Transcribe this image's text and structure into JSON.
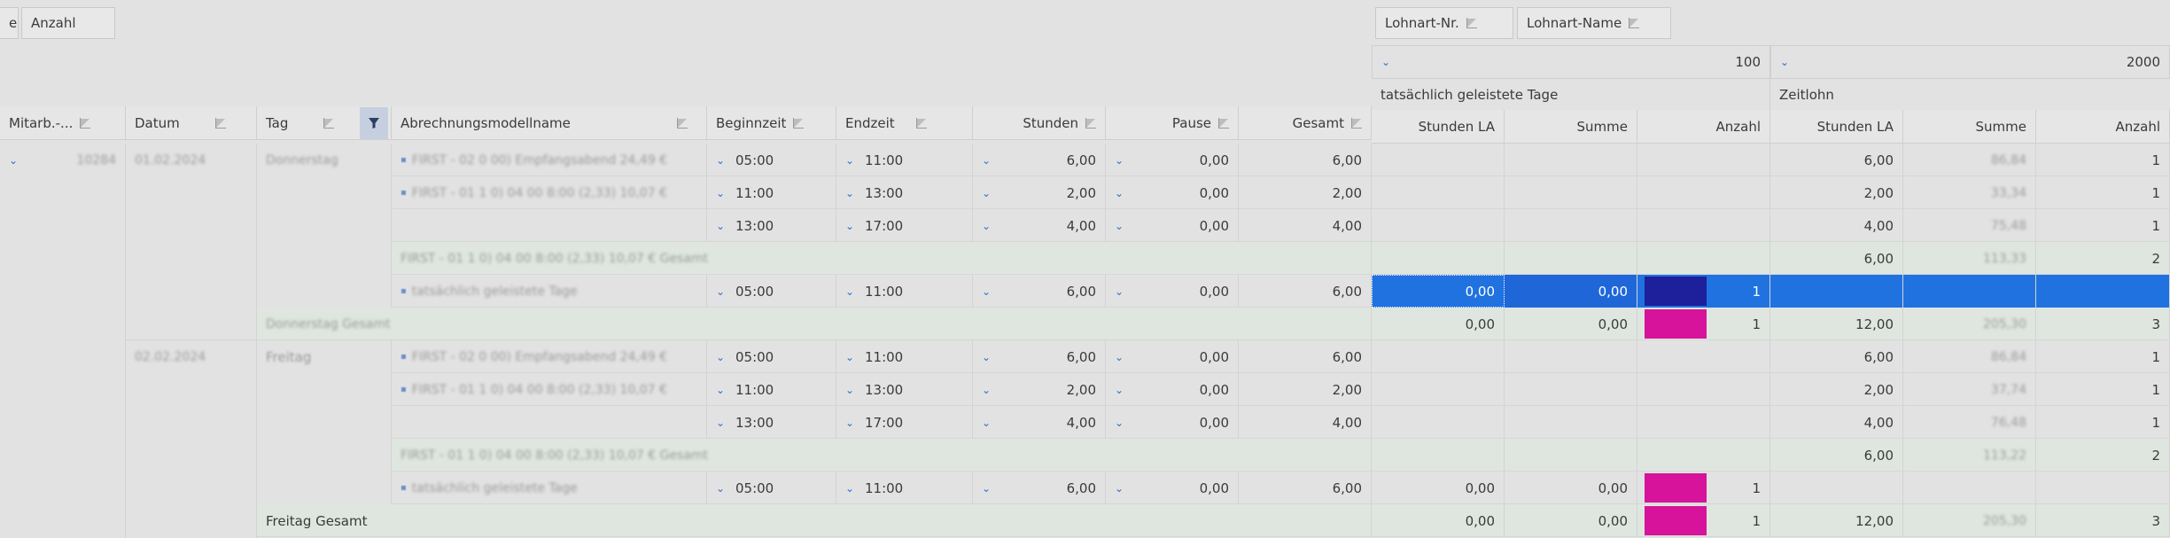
{
  "group_chips": [
    "e",
    "Anzahl"
  ],
  "pivot_chips": [
    "Lohnart-Nr.",
    "Lohnart-Name"
  ],
  "pivot_groups": [
    {
      "nr": "100",
      "name": "tatsächlich geleistete Tage"
    },
    {
      "nr": "2000",
      "name": "Zeitlohn"
    }
  ],
  "columns": [
    "Mitarb.-...",
    "Datum",
    "Tag",
    "Abrechnungsmodellname",
    "Beginnzeit",
    "Endzeit",
    "Stunden",
    "Pause",
    "Gesamt"
  ],
  "value_columns": [
    "Stunden LA",
    "Summe",
    "Anzahl",
    "Stunden LA",
    "Summe",
    "Anzahl"
  ],
  "mitarb_value": "10284",
  "dates": [
    "01.02.2024",
    "02.02.2024"
  ],
  "days": [
    "Donnerstag",
    "Freitag"
  ],
  "models": [
    "FIRST - 02 0 00) Empfangsabend 24,49 €",
    "FIRST - 01 1 0) 04 00 8:00 (2,33) 10,07 €",
    "FIRST - 01 1 0) 04 00 8:00 (2,33) 10,07 € Gesamt",
    "tatsächlich geleistete Tage"
  ],
  "day_totals": [
    "Donnerstag Gesamt",
    "Freitag Gesamt"
  ],
  "rows": [
    {
      "begin": "05:00",
      "end": "11:00",
      "stunden": "6,00",
      "pause": "0,00",
      "gesamt": "6,00",
      "p1": [
        "",
        "",
        ""
      ],
      "p2": [
        "6,00",
        "86,84",
        "1"
      ]
    },
    {
      "begin": "11:00",
      "end": "13:00",
      "stunden": "2,00",
      "pause": "0,00",
      "gesamt": "2,00",
      "p1": [
        "",
        "",
        ""
      ],
      "p2": [
        "2,00",
        "33,34",
        "1"
      ]
    },
    {
      "begin": "13:00",
      "end": "17:00",
      "stunden": "4,00",
      "pause": "0,00",
      "gesamt": "4,00",
      "p1": [
        "",
        "",
        ""
      ],
      "p2": [
        "4,00",
        "75,48",
        "1"
      ]
    },
    {
      "p2": [
        "6,00",
        "113,33",
        "2"
      ]
    },
    {
      "begin": "05:00",
      "end": "11:00",
      "stunden": "6,00",
      "pause": "0,00",
      "gesamt": "6,00",
      "p1": [
        "0,00",
        "0,00",
        "1"
      ]
    },
    {
      "p1": [
        "0,00",
        "0,00",
        "1"
      ],
      "p2": [
        "12,00",
        "205,30",
        "3"
      ]
    },
    {
      "begin": "05:00",
      "end": "11:00",
      "stunden": "6,00",
      "pause": "0,00",
      "gesamt": "6,00",
      "p2": [
        "6,00",
        "86,84",
        "1"
      ]
    },
    {
      "begin": "11:00",
      "end": "13:00",
      "stunden": "2,00",
      "pause": "0,00",
      "gesamt": "2,00",
      "p2": [
        "2,00",
        "37,74",
        "1"
      ]
    },
    {
      "begin": "13:00",
      "end": "17:00",
      "stunden": "4,00",
      "pause": "0,00",
      "gesamt": "4,00",
      "p2": [
        "4,00",
        "76,48",
        "1"
      ]
    },
    {
      "p2": [
        "6,00",
        "113,22",
        "2"
      ]
    },
    {
      "begin": "05:00",
      "end": "11:00",
      "stunden": "6,00",
      "pause": "0,00",
      "gesamt": "6,00",
      "p1": [
        "0,00",
        "0,00",
        "1"
      ]
    },
    {
      "p1": [
        "0,00",
        "0,00",
        "1"
      ],
      "p2": [
        "12,00",
        "205,30",
        "3"
      ]
    }
  ],
  "colors": {
    "selection": "#1f72e0",
    "magenta": "#d6139a",
    "navy": "#1e1f9a",
    "chevron": "#2a6fd6"
  }
}
